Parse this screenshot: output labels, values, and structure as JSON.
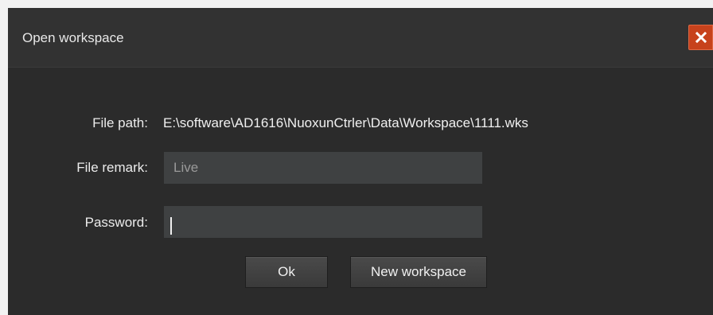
{
  "window": {
    "title": "Open workspace",
    "close_icon": "close-icon",
    "close_color": "#c7421c"
  },
  "form": {
    "file_path_label": "File path:",
    "file_path_value": "E:\\software\\AD1616\\NuoxunCtrler\\Data\\Workspace\\1111.wks",
    "file_remark_label": "File remark:",
    "file_remark_value": "Live",
    "password_label": "Password:",
    "password_value": ""
  },
  "buttons": {
    "ok_label": "Ok",
    "new_workspace_label": "New workspace"
  }
}
